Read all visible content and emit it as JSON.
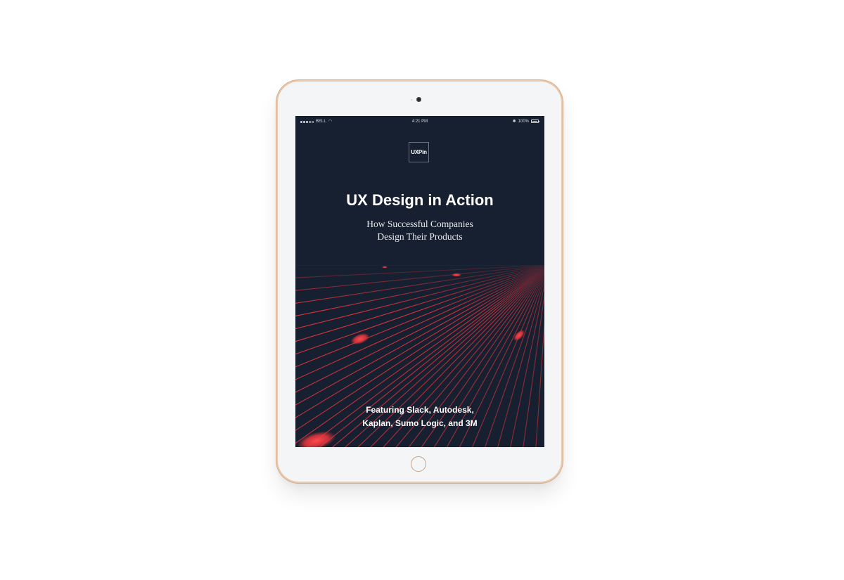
{
  "status_bar": {
    "carrier": "BELL",
    "time": "4:21 PM",
    "battery": "100%",
    "battery_level": 1.0
  },
  "cover": {
    "logo": "UXPin",
    "title": "UX Design in Action",
    "subtitle_line1": "How Successful Companies",
    "subtitle_line2": "Design Their Products",
    "featuring_line1": "Featuring Slack, Autodesk,",
    "featuring_line2": "Kaplan, Sumo Logic, and 3M"
  },
  "colors": {
    "screen_bg": "#172030",
    "accent_red": "#e8363c",
    "device_frame": "#f4f5f7",
    "device_edge": "#d7ad8c"
  },
  "icons": [
    "signal-icon",
    "wifi-icon",
    "bluetooth-icon",
    "battery-icon",
    "camera-icon",
    "home-button-icon"
  ]
}
